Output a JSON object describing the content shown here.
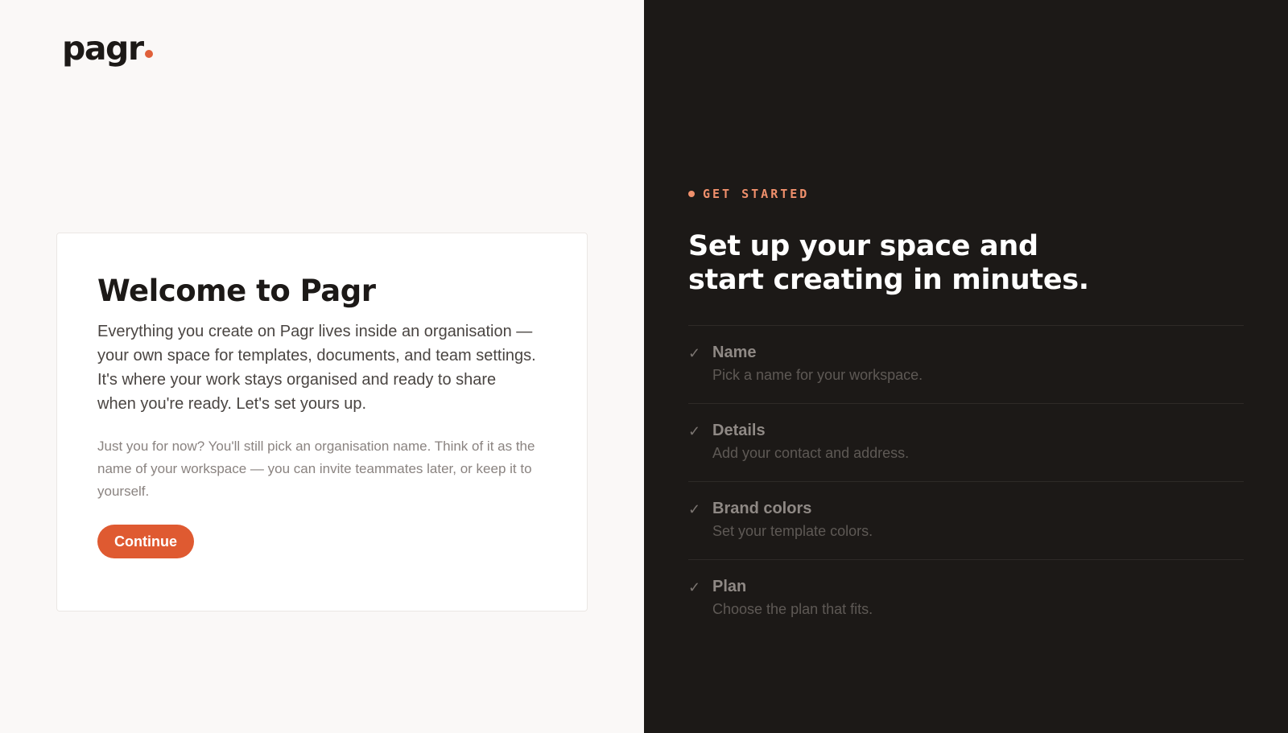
{
  "brand": {
    "name": "pagr",
    "accent": "#e0603a"
  },
  "welcome": {
    "title": "Welcome to Pagr",
    "lead": "Everything you create on Pagr lives inside an organisation — your own space for templates, documents, and team settings. It's where your work stays organised and ready to share when you're ready. Let's set yours up.",
    "note": "Just you for now? You'll still pick an organisation name. Think of it as the name of your workspace — you can invite teammates later, or keep it to yourself.",
    "continue_label": "Continue"
  },
  "onboarding": {
    "eyebrow": "GET STARTED",
    "headline": "Set up your space and start creating in minutes.",
    "steps": [
      {
        "check": "✓",
        "title": "Name",
        "desc": "Pick a name for your workspace."
      },
      {
        "check": "✓",
        "title": "Details",
        "desc": "Add your contact and address."
      },
      {
        "check": "✓",
        "title": "Brand colors",
        "desc": "Set your template colors."
      },
      {
        "check": "✓",
        "title": "Plan",
        "desc": "Choose the plan that fits."
      }
    ]
  }
}
